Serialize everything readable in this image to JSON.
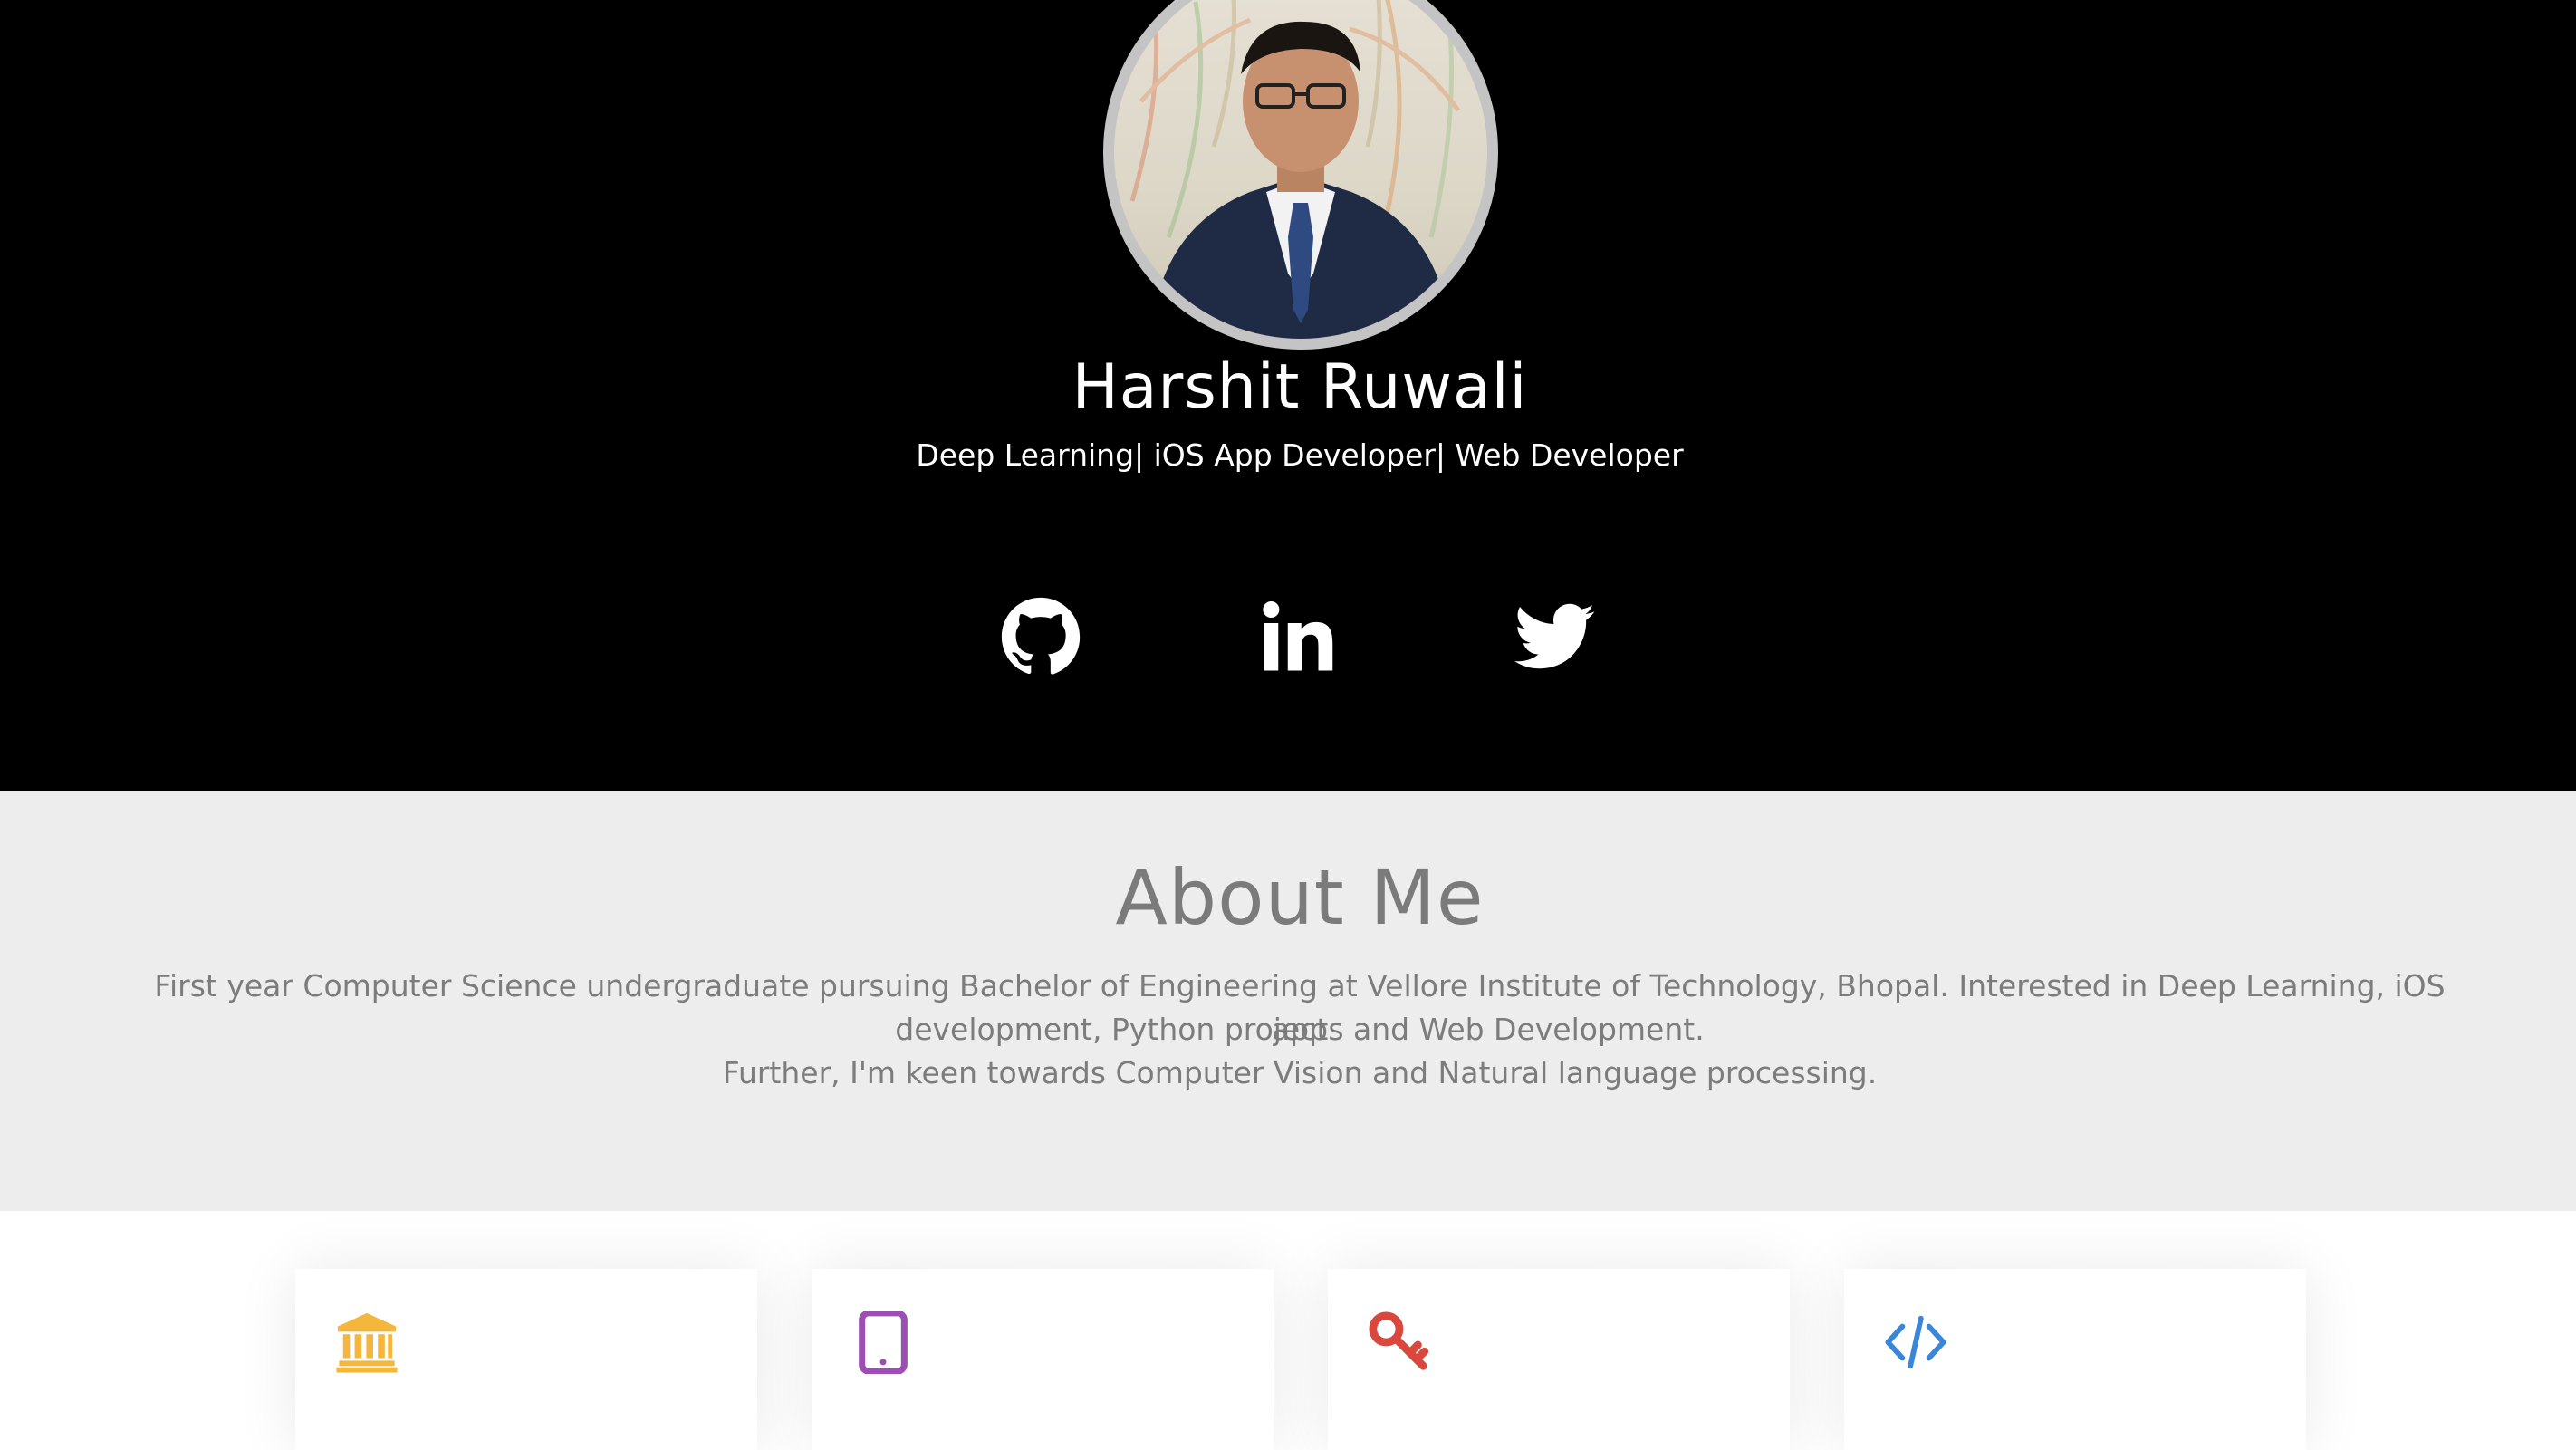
{
  "profile": {
    "name": "Harshit Ruwali",
    "tagline": "Deep Learning| iOS App Developer| Web Developer"
  },
  "social": [
    {
      "name": "github-icon",
      "icon": "github"
    },
    {
      "name": "linkedin-icon",
      "icon": "linkedin"
    },
    {
      "name": "twitter-icon",
      "icon": "twitter"
    }
  ],
  "about": {
    "title": "About Me",
    "line1": "First year Computer Science undergraduate pursuing Bachelor of Engineering at Vellore Institute of Technology, Bhopal. Interested in Deep Learning, iOS app",
    "line2": "development, Python projects and Web Development.",
    "line3": "Further, I'm keen towards Computer Vision and Natural language processing."
  },
  "cards": [
    {
      "icon": "bank-icon",
      "color": "#f4b63c"
    },
    {
      "icon": "tablet-icon",
      "color": "#9b4fb2"
    },
    {
      "icon": "key-icon",
      "color": "#d9473d"
    },
    {
      "icon": "code-icon",
      "color": "#3a86d8"
    }
  ],
  "colors": {
    "hero_bg": "#000000",
    "about_bg": "#ededed",
    "text_grey": "#7b7b7b"
  }
}
